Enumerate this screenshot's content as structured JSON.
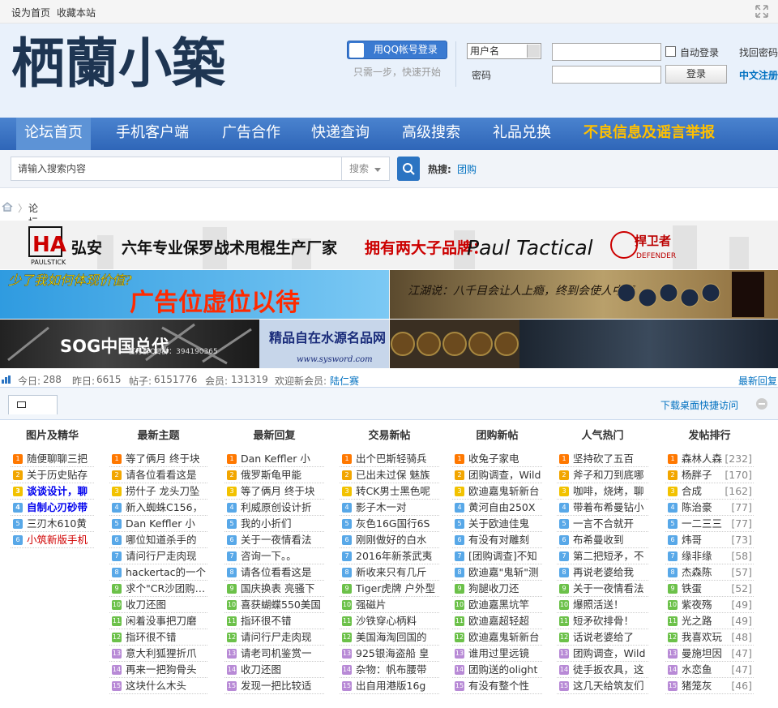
{
  "topbar": {
    "set_home": "设为首页",
    "bookmark": "收藏本站"
  },
  "header": {
    "logo_text": "栖蘭小築",
    "qq_login": "用QQ帐号登录",
    "qq_sub": "只需一步，快速开始",
    "username_select": "用户名",
    "password_label": "密码",
    "auto_login": "自动登录",
    "login_button": "登录",
    "find_password": "找回密码",
    "register": "中文注册"
  },
  "nav": {
    "items": [
      "论坛首页",
      "手机客户端",
      "广告合作",
      "快递查询",
      "高级搜索",
      "礼品兑换"
    ],
    "report": "不良信息及谣言举报"
  },
  "search": {
    "placeholder": "请输入搜索内容",
    "type": "搜索",
    "hot_label": "热搜:",
    "hot_term": "团购"
  },
  "breadcrumb": {
    "current": "论坛首页"
  },
  "banners": {
    "b1_brand": "弘安",
    "b1_logo": "PAULSTICK",
    "b1_main": "六年专业保罗战术甩棍生产厂家",
    "b1_brands": "拥有两大子品牌：",
    "b1_paul": "Paul Tactical",
    "b1_defender": "捍卫者",
    "b1_defender_en": "DEFENDER",
    "b2_top": "少了我如何体现价值?",
    "b2_main": "广告位虚位以待",
    "b2_right": "江湖说：八千目会让人上瘾，终到会使人中毒",
    "b3_sog": "SOG中国总代",
    "b3_sog_sub": "官方群QQ群：394190365",
    "b3_mid": "精品自在水源名品网",
    "b3_url": "www.sysword.com"
  },
  "stats": {
    "today_label": "今日:",
    "today": "288",
    "yesterday_label": "昨日:",
    "yesterday": "6615",
    "posts_label": "帖子:",
    "posts": "6151776",
    "members_label": "会员:",
    "members": "131319",
    "welcome_label": "欢迎新会员:",
    "new_member": "陆仁赛",
    "latest_reply": "最新回复"
  },
  "portal": {
    "download_link": "下载桌面快捷访问"
  },
  "columns": [
    {
      "title": "图片及精华",
      "items": [
        "随便聊聊三把",
        "关于历史贴存",
        "谈谈设计，聊",
        "自制心刃砂带",
        "三刃木610黄",
        "小筑新版手机"
      ]
    },
    {
      "title": "最新主题",
      "items": [
        "等了俩月 终于块",
        "请各位看看这是",
        "捞什子 龙头刀坠",
        "新入蜘蛛C156，",
        "Dan Keffler 小",
        "哪位知道杀手的",
        "请问行尸走肉现",
        "hackertac的一个",
        "求个\"CR沙团购…",
        "收刀还图",
        "闲着没事把刀磨",
        "指环很不错",
        "意大利狐狸折爪",
        "再来一把狗骨头",
        "这块什么木头"
      ]
    },
    {
      "title": "最新回复",
      "items": [
        "Dan Keffler 小",
        "俄罗斯龟甲能",
        "等了俩月 终于块",
        "利威原创设计折",
        "我的小折们",
        "关于一夜情看法",
        "咨询一下。。",
        "请各位看看这是",
        "国庆换表 亮骚下",
        "喜获蝴蝶550美国",
        "指环很不错",
        "请问行尸走肉现",
        "请老司机鉴赏一",
        "收刀还图",
        "发现一把比较适"
      ]
    },
    {
      "title": "交易新帖",
      "items": [
        "出个巴斯轻骑兵",
        "已出未过保 魅族",
        "转CK男士黑色呢",
        "影子木一对",
        "灰色16G国行6S",
        "刚刚做好的白水",
        "2016年新茶武夷",
        "新收来只有几斤",
        "Tiger虎牌 户外型",
        "强磁片",
        "沙铁穿心柄料",
        "美国海淘回国的",
        "925银海盗船 皇",
        "杂物：帆布腰带",
        "出自用港版16g"
      ]
    },
    {
      "title": "团购新帖",
      "items": [
        "收兔子家电",
        "团购调查，Wild",
        "欧迪嘉鬼斩新台",
        "黄河自由250X",
        "关于欧迪佳鬼",
        "有没有对雕刻",
        "[团购调查]不知",
        "欧迪嘉\"鬼斩\"测",
        "狗腿收刀还",
        "欧迪嘉黑坑竿",
        "欧迪嘉超轻超",
        "欧迪嘉鬼斩新台",
        "谁用过里远镜",
        "团购送的olight",
        "有没有整个性"
      ]
    },
    {
      "title": "人气热门",
      "items": [
        "坚持砍了五百",
        "斧子和刀到底哪",
        "咖啡，烧烤，聊",
        "带着布希曼钻小",
        "一言不合就开",
        "布希曼收到",
        "第二把短矛，不",
        "再说老婆给我",
        "关于一夜情看法",
        "爆照活送！",
        "短矛砍排骨！",
        "话说老婆给了",
        "团购调查，Wild",
        "徒手扳农具，这",
        "这几天给筑友们"
      ]
    },
    {
      "title": "发帖排行",
      "items": [
        "森林人森",
        "杨胖子",
        "合成",
        "陈治豪",
        "一二三三",
        "炜哥",
        "缘非缘",
        "杰森陈",
        "铁蛋",
        "紫夜殇",
        "光之路",
        "我喜欢玩",
        "曼施坦因",
        "水恋鱼",
        "猪笼灰"
      ],
      "counts": [
        "[232]",
        "[170]",
        "[162]",
        "[77]",
        "[77]",
        "[73]",
        "[58]",
        "[57]",
        "[52]",
        "[49]",
        "[49]",
        "[48]",
        "[47]",
        "[47]",
        "[46]"
      ]
    }
  ],
  "colors": {
    "nav_bg": "#3a74c4",
    "link_blue": "#0070c0",
    "report_orange": "#ffc000"
  }
}
